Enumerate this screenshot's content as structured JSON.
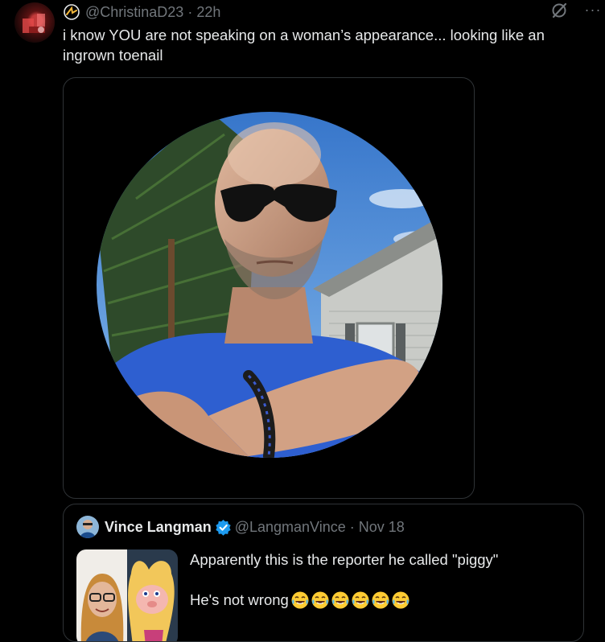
{
  "tweet": {
    "handle": "@ChristinaD23",
    "separator": "·",
    "time": "22h",
    "text": "i know YOU are not speaking on a woman’s appearance... looking like an ingrown toenail",
    "more": "···"
  },
  "quote": {
    "name": "Vince Langman",
    "handle": "@LangmanVince",
    "separator": "·",
    "time": "Nov 18",
    "line1": "Apparently this is the reporter he called \"piggy\"",
    "line2": "He's not wrong",
    "emoji_count": 6
  },
  "colors": {
    "background": "#000000",
    "text": "#e7e9ea",
    "muted": "#71767b",
    "border": "#2f3336",
    "verified": "#1d9bf0"
  },
  "icons": [
    "badge-icon",
    "grok-icon",
    "more-icon",
    "verified-icon",
    "laughing-emoji-icon"
  ]
}
